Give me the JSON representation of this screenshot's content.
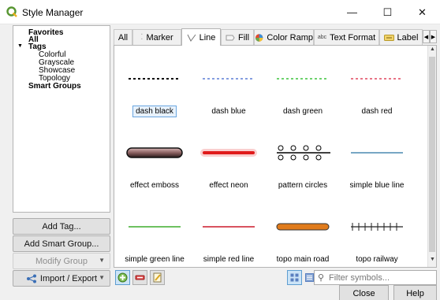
{
  "window": {
    "title": "Style Manager",
    "minimize_glyph": "—",
    "maximize_glyph": "☐",
    "close_glyph": "✕"
  },
  "tree": {
    "favorites": "Favorites",
    "all": "All",
    "tags": "Tags",
    "tag_items": [
      "Colorful",
      "Grayscale",
      "Showcase",
      "Topology"
    ],
    "smart_groups": "Smart Groups",
    "expand_glyph": "▼"
  },
  "buttons": {
    "add_tag": "Add Tag...",
    "add_smart_group": "Add Smart Group...",
    "modify_group": "Modify Group",
    "import_export": "Import / Export"
  },
  "tabs": [
    {
      "label": "All",
      "icon": ""
    },
    {
      "label": "Marker",
      "icon": "marker-icon"
    },
    {
      "label": "Line",
      "icon": "line-icon"
    },
    {
      "label": "Fill",
      "icon": "fill-icon"
    },
    {
      "label": "Color Ramp",
      "icon": "color-ramp-icon"
    },
    {
      "label": "Text Format",
      "icon": "text-format-icon"
    },
    {
      "label": "Label",
      "icon": "label-icon"
    }
  ],
  "active_tab": "Line",
  "symbols": [
    {
      "name": "dash  black",
      "color": "#000000",
      "selected": true
    },
    {
      "name": "dash blue",
      "color": "#5b7fd6"
    },
    {
      "name": "dash green",
      "color": "#3cc43c"
    },
    {
      "name": "dash red",
      "color": "#e0465e"
    },
    {
      "name": "effect emboss",
      "color": "#5a3a3a"
    },
    {
      "name": "effect neon",
      "color": "#e01a1a"
    },
    {
      "name": "pattern circles",
      "color": "#000000"
    },
    {
      "name": "simple blue line",
      "color": "#4a8ab0"
    },
    {
      "name": "simple green line",
      "color": "#5ab84a"
    },
    {
      "name": "simple red line",
      "color": "#d23a48"
    },
    {
      "name": "topo main road",
      "color": "#e07b1c"
    },
    {
      "name": "topo railway",
      "color": "#222222"
    }
  ],
  "filter": {
    "placeholder": "Filter symbols..."
  },
  "footer": {
    "close": "Close",
    "help": "Help"
  },
  "colors": {
    "accent": "#6aa6e0",
    "qgis_green": "#589632"
  }
}
